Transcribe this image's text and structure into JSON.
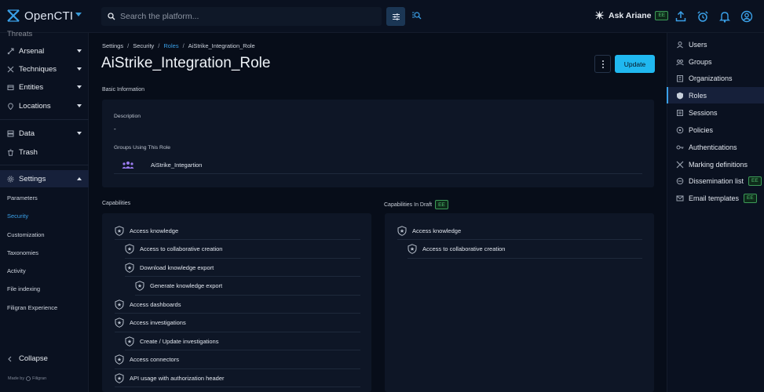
{
  "app": {
    "name": "OpenCTI"
  },
  "topbar": {
    "search_placeholder": "Search the platform...",
    "ask_ariane": "Ask Ariane",
    "ee_badge": "EE",
    "icons": [
      "filter-icon",
      "ai-search-icon",
      "upload-icon",
      "alarm-icon",
      "bell-icon",
      "account-icon"
    ]
  },
  "sidebar": {
    "top_partial": "Threats",
    "items": [
      {
        "label": "Arsenal",
        "icon": "arsenal-icon"
      },
      {
        "label": "Techniques",
        "icon": "techniques-icon"
      },
      {
        "label": "Entities",
        "icon": "entities-icon"
      },
      {
        "label": "Locations",
        "icon": "locations-icon"
      },
      {
        "label": "Data",
        "icon": "data-icon"
      },
      {
        "label": "Trash",
        "icon": "trash-icon"
      },
      {
        "label": "Settings",
        "icon": "settings-icon"
      }
    ],
    "settings_sub": [
      "Parameters",
      "Security",
      "Customization",
      "Taxonomies",
      "Activity",
      "File indexing",
      "Filigran Experience"
    ],
    "collapse": "Collapse",
    "made_by": "Made by",
    "made_by_brand": "Filigran"
  },
  "breadcrumb": [
    "Settings",
    "Security",
    "Roles",
    "AiStrike_Integration_Role"
  ],
  "page": {
    "title": "AiStrike_Integration_Role",
    "update_label": "Update",
    "basic_info_label": "Basic Information",
    "description_label": "Description",
    "description_value": "-",
    "groups_label": "Groups Using This Role",
    "group_name": "AiStrike_Integartion"
  },
  "capabilities": {
    "label": "Capabilities",
    "items": [
      {
        "text": "Access knowledge",
        "level": 0
      },
      {
        "text": "Access to collaborative creation",
        "level": 1
      },
      {
        "text": "Download knowledge export",
        "level": 1
      },
      {
        "text": "Generate knowledge export",
        "level": 2
      },
      {
        "text": "Access dashboards",
        "level": 0
      },
      {
        "text": "Access investigations",
        "level": 0
      },
      {
        "text": "Create / Update investigations",
        "level": 1
      },
      {
        "text": "Access connectors",
        "level": 0
      },
      {
        "text": "API usage with authorization header",
        "level": 0
      }
    ]
  },
  "capabilities_draft": {
    "label": "Capabilities In Draft",
    "badge": "EE",
    "items": [
      {
        "text": "Access knowledge",
        "level": 0
      },
      {
        "text": "Access to collaborative creation",
        "level": 1
      }
    ]
  },
  "right_nav": {
    "items": [
      {
        "label": "Users",
        "icon": "users-icon"
      },
      {
        "label": "Groups",
        "icon": "groups-icon"
      },
      {
        "label": "Organizations",
        "icon": "organizations-icon"
      },
      {
        "label": "Roles",
        "icon": "roles-icon"
      },
      {
        "label": "Sessions",
        "icon": "sessions-icon"
      },
      {
        "label": "Policies",
        "icon": "policies-icon"
      },
      {
        "label": "Authentications",
        "icon": "authentications-icon"
      },
      {
        "label": "Marking definitions",
        "icon": "marking-icon"
      },
      {
        "label": "Dissemination list",
        "icon": "dissemination-icon",
        "badge": "EE"
      },
      {
        "label": "Email templates",
        "icon": "email-icon",
        "badge": "EE"
      }
    ],
    "active": "Roles"
  },
  "colors": {
    "accent": "#3aa0e8",
    "update_button": "#20b8f0",
    "ee_green": "#4ec06e",
    "background": "#070d19",
    "panel": "#0e1626"
  }
}
